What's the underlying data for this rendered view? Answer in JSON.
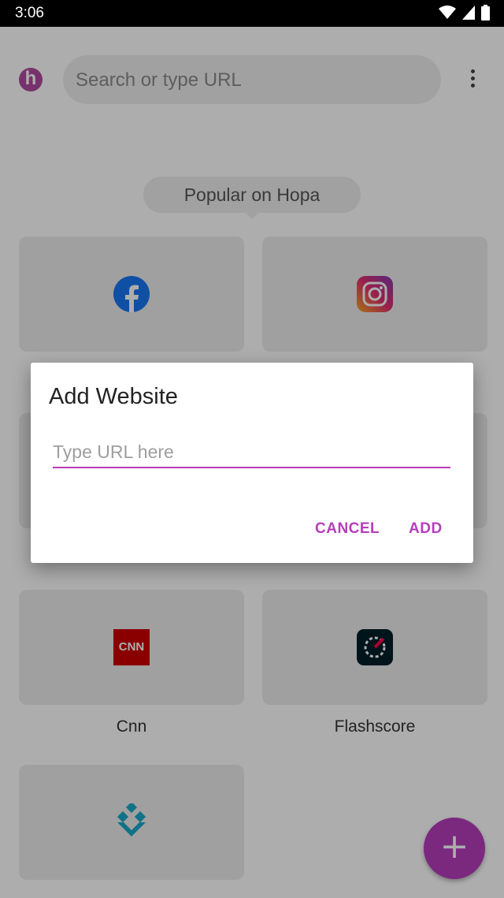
{
  "status_bar": {
    "time": "3:06",
    "icons": [
      "wifi-icon",
      "cell-signal-icon",
      "battery-icon"
    ]
  },
  "browser": {
    "logo_letter": "h",
    "search_placeholder": "Search or type URL",
    "popular_label": "Popular on Hopa"
  },
  "tiles": [
    {
      "icon": "facebook-icon",
      "label": ""
    },
    {
      "icon": "instagram-icon",
      "label": ""
    },
    {
      "icon": "cnn-icon",
      "label": "Cnn",
      "icon_text": "CNN"
    },
    {
      "icon": "flashscore-icon",
      "label": "Flashscore"
    },
    {
      "icon": "download-arrow-icon",
      "label": ""
    }
  ],
  "dialog": {
    "title": "Add Website",
    "input_placeholder": "Type URL here",
    "cancel_label": "CANCEL",
    "add_label": "ADD"
  },
  "fab": {
    "label": "+"
  },
  "colors": {
    "accent": "#b63dbb",
    "logo": "#b04aa0",
    "tile_bg": "#ececec",
    "facebook": "#1877f2",
    "cnn": "#cc0000"
  }
}
